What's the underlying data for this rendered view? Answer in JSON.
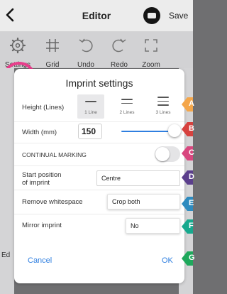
{
  "header": {
    "title": "Editor",
    "save_label": "Save"
  },
  "toolbar": {
    "items": [
      {
        "label": "Settings",
        "icon": "gear-icon"
      },
      {
        "label": "Grid",
        "icon": "grid-icon"
      },
      {
        "label": "Undo",
        "icon": "undo-icon"
      },
      {
        "label": "Redo",
        "icon": "redo-icon"
      },
      {
        "label": "Zoom",
        "icon": "zoom-frame-icon"
      }
    ],
    "highlight_color": "#e83e8c"
  },
  "background": {
    "edit_fragment": "Ed"
  },
  "dialog": {
    "title": "Imprint settings",
    "height": {
      "label": "Height (Lines)",
      "options": [
        "1 Line",
        "2 Lines",
        "3 Lines"
      ],
      "selected": "1 Line"
    },
    "width": {
      "label": "Width (mm)",
      "value": "150",
      "slider_level": 0.95
    },
    "continual_marking": {
      "label": "CONTINUAL MARKING",
      "enabled": false
    },
    "start_position": {
      "label_line1": "Start position",
      "label_line2": "of imprint",
      "value": "Centre"
    },
    "remove_whitespace": {
      "label": "Remove whitespace",
      "value": "Crop both"
    },
    "mirror_imprint": {
      "label": "Mirror imprint",
      "value": "No"
    },
    "cancel_label": "Cancel",
    "ok_label": "OK",
    "accent_color": "#2f7fe0"
  },
  "callouts": [
    {
      "letter": "A",
      "color": "#f4a64a"
    },
    {
      "letter": "B",
      "color": "#d6423f"
    },
    {
      "letter": "C",
      "color": "#d8477f"
    },
    {
      "letter": "D",
      "color": "#5b3f8c"
    },
    {
      "letter": "E",
      "color": "#2e8bbf"
    },
    {
      "letter": "F",
      "color": "#17a98e"
    },
    {
      "letter": "G",
      "color": "#1fa85c"
    }
  ]
}
